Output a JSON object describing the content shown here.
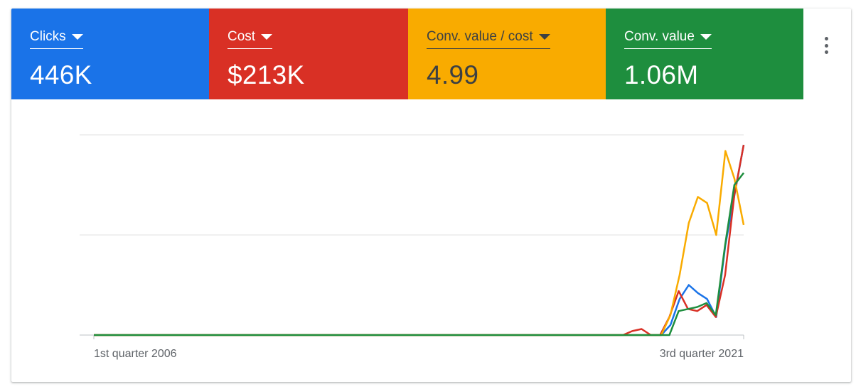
{
  "scorecards": [
    {
      "label": "Clicks",
      "value": "446K",
      "color": "#1a73e8",
      "text_color": "#ffffff"
    },
    {
      "label": "Cost",
      "value": "$213K",
      "color": "#d93025",
      "text_color": "#ffffff"
    },
    {
      "label": "Conv. value / cost",
      "value": "4.99",
      "color": "#f9ab00",
      "text_color": "#3c4043"
    },
    {
      "label": "Conv. value",
      "value": "1.06M",
      "color": "#1e8e3e",
      "text_color": "#ffffff"
    }
  ],
  "menu_icon": "more-vert-icon",
  "chart_data": {
    "type": "line",
    "x_tick_labels": [
      "1st quarter 2006",
      "3rd quarter 2021"
    ],
    "grid": true,
    "y_axis_labels": false,
    "series": [
      {
        "name": "Clicks",
        "color": "#1a73e8",
        "values": [
          0,
          0,
          0,
          0,
          0,
          0,
          0,
          0,
          0,
          0,
          0,
          0,
          0,
          0,
          0,
          0,
          0,
          0,
          0,
          0,
          0,
          0,
          0,
          0,
          0,
          0,
          0,
          0,
          0,
          0,
          0,
          0,
          0,
          0,
          0,
          0,
          0,
          0,
          0,
          0,
          0,
          0,
          0,
          0,
          0,
          0,
          0,
          0,
          0,
          0,
          0,
          0,
          0,
          0,
          0,
          0,
          0,
          0,
          0,
          0,
          0,
          0,
          0,
          0.05,
          0.18,
          0.25,
          0.21,
          0.18,
          0.09,
          0.45,
          0.7,
          0.95
        ]
      },
      {
        "name": "Cost",
        "color": "#d93025",
        "values": [
          0,
          0,
          0,
          0,
          0,
          0,
          0,
          0,
          0,
          0,
          0,
          0,
          0,
          0,
          0,
          0,
          0,
          0,
          0,
          0,
          0,
          0,
          0,
          0,
          0,
          0,
          0,
          0,
          0,
          0,
          0,
          0,
          0,
          0,
          0,
          0,
          0,
          0,
          0,
          0,
          0,
          0,
          0,
          0,
          0,
          0,
          0,
          0,
          0,
          0,
          0,
          0,
          0,
          0,
          0,
          0,
          0,
          0,
          0.02,
          0.03,
          0,
          0,
          0.09,
          0.22,
          0.13,
          0.12,
          0.15,
          0.09,
          0.3,
          0.7,
          0.95
        ]
      },
      {
        "name": "Conv. value / cost",
        "color": "#f9ab00",
        "values": [
          0,
          0,
          0,
          0,
          0,
          0,
          0,
          0,
          0,
          0,
          0,
          0,
          0,
          0,
          0,
          0,
          0,
          0,
          0,
          0,
          0,
          0,
          0,
          0,
          0,
          0,
          0,
          0,
          0,
          0,
          0,
          0,
          0,
          0,
          0,
          0,
          0,
          0,
          0,
          0,
          0,
          0,
          0,
          0,
          0,
          0,
          0,
          0,
          0,
          0,
          0,
          0,
          0,
          0,
          0,
          0,
          0,
          0,
          0,
          0,
          0,
          0,
          0,
          0.1,
          0.3,
          0.56,
          0.69,
          0.66,
          0.5,
          0.92,
          0.78,
          0.55
        ]
      },
      {
        "name": "Conv. value",
        "color": "#1e8e3e",
        "values": [
          0,
          0,
          0,
          0,
          0,
          0,
          0,
          0,
          0,
          0,
          0,
          0,
          0,
          0,
          0,
          0,
          0,
          0,
          0,
          0,
          0,
          0,
          0,
          0,
          0,
          0,
          0,
          0,
          0,
          0,
          0,
          0,
          0,
          0,
          0,
          0,
          0,
          0,
          0,
          0,
          0,
          0,
          0,
          0,
          0,
          0,
          0,
          0,
          0,
          0,
          0,
          0,
          0,
          0,
          0,
          0,
          0,
          0,
          0,
          0,
          0,
          0,
          0,
          0.12,
          0.13,
          0.14,
          0.16,
          0.1,
          0.45,
          0.75,
          0.81
        ]
      }
    ]
  }
}
